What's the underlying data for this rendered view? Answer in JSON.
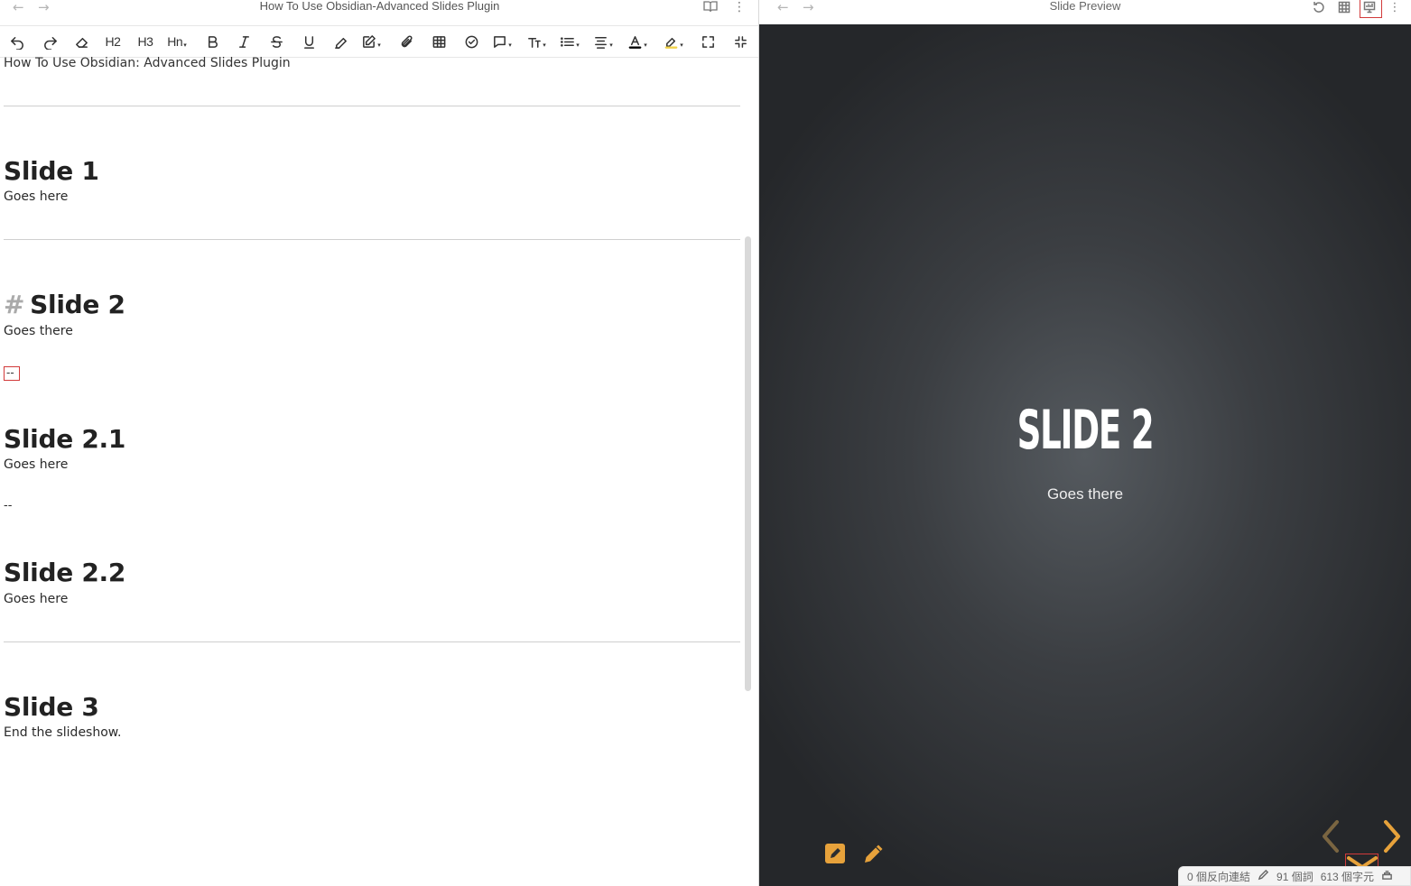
{
  "editor": {
    "window_title": "How To Use Obsidian-Advanced Slides Plugin",
    "toolbar": [
      {
        "icon": "undo-icon"
      },
      {
        "icon": "redo-icon"
      },
      {
        "icon": "eraser-icon"
      },
      {
        "label": "H2"
      },
      {
        "label": "H3"
      },
      {
        "label": "Hn"
      },
      {
        "icon": "bold-icon"
      },
      {
        "icon": "italic-icon"
      },
      {
        "icon": "strikethrough-icon"
      },
      {
        "icon": "underline-icon"
      },
      {
        "icon": "highlighter-icon"
      },
      {
        "icon": "edit-box-icon"
      },
      {
        "icon": "paperclip-icon"
      },
      {
        "icon": "table-icon"
      },
      {
        "icon": "check-circle-icon"
      },
      {
        "icon": "comment-icon"
      },
      {
        "icon": "text-size-icon"
      },
      {
        "icon": "list-icon"
      },
      {
        "icon": "align-icon"
      },
      {
        "icon": "text-color-icon"
      },
      {
        "icon": "fill-color-icon"
      },
      {
        "icon": "fullscreen-icon"
      },
      {
        "icon": "shrink-icon"
      }
    ],
    "doc": {
      "title_line": "How To Use Obsidian: Advanced Slides Plugin",
      "slide1_heading": "Slide 1",
      "slide1_body": "Goes here",
      "slide2_hash": "#",
      "slide2_heading": "Slide 2",
      "slide2_body": "Goes there",
      "separator1": "--",
      "slide21_heading": "Slide 2.1",
      "slide21_body": "Goes here",
      "separator2": "--",
      "slide22_heading": "Slide 2.2",
      "slide22_body": "Goes here",
      "slide3_heading": "Slide 3",
      "slide3_body": "End the slideshow."
    }
  },
  "preview": {
    "window_title": "Slide Preview",
    "slide_heading": "SLIDE 2",
    "slide_body": "Goes there",
    "accent_color": "#e7a23b"
  },
  "status_bar": {
    "backlinks": "0 個反向連結",
    "words": "91 個詞",
    "chars": "613 個字元"
  }
}
